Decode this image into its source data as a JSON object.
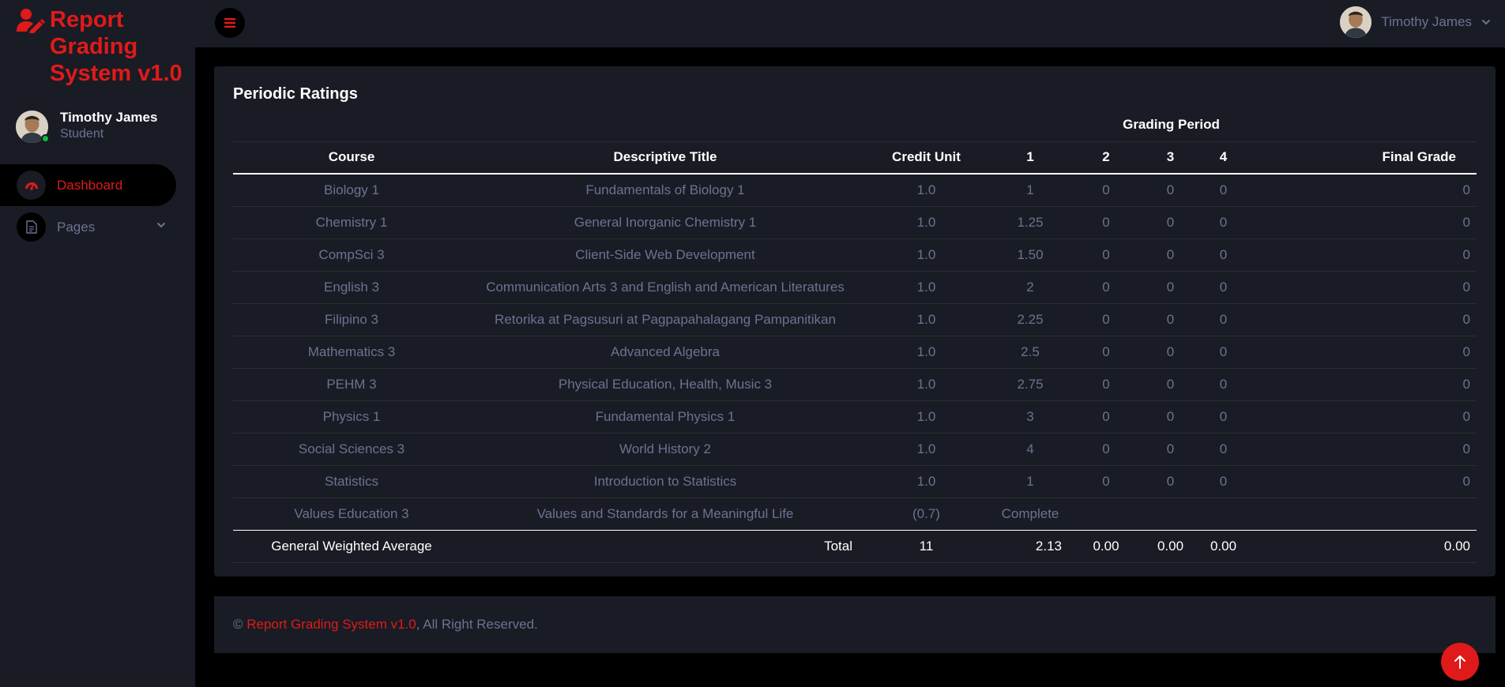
{
  "brand": {
    "title": "Report Grading System v1.0"
  },
  "sidebar": {
    "profile": {
      "name": "Timothy James",
      "role": "Student"
    },
    "items": [
      {
        "label": "Dashboard",
        "icon": "speedometer-icon",
        "active": true
      },
      {
        "label": "Pages",
        "icon": "document-icon",
        "active": false
      }
    ]
  },
  "topbar": {
    "user_name": "Timothy James"
  },
  "main": {
    "card_title": "Periodic Ratings",
    "table": {
      "group_header": "Grading Period",
      "headers": [
        "Course",
        "Descriptive Title",
        "Credit Unit",
        "1",
        "2",
        "3",
        "4",
        "Final Grade"
      ],
      "rows": [
        [
          "Biology 1",
          "Fundamentals of Biology 1",
          "1.0",
          "1",
          "0",
          "0",
          "0",
          "0"
        ],
        [
          "Chemistry 1",
          "General Inorganic Chemistry 1",
          "1.0",
          "1.25",
          "0",
          "0",
          "0",
          "0"
        ],
        [
          "CompSci 3",
          "Client-Side Web Development",
          "1.0",
          "1.50",
          "0",
          "0",
          "0",
          "0"
        ],
        [
          "English 3",
          "Communication Arts 3 and English and American Literatures",
          "1.0",
          "2",
          "0",
          "0",
          "0",
          "0"
        ],
        [
          "Filipino 3",
          "Retorika at Pagsusuri at Pagpapahalagang Pampanitikan",
          "1.0",
          "2.25",
          "0",
          "0",
          "0",
          "0"
        ],
        [
          "Mathematics 3",
          "Advanced Algebra",
          "1.0",
          "2.5",
          "0",
          "0",
          "0",
          "0"
        ],
        [
          "PEHM 3",
          "Physical Education, Health, Music 3",
          "1.0",
          "2.75",
          "0",
          "0",
          "0",
          "0"
        ],
        [
          "Physics 1",
          "Fundamental Physics 1",
          "1.0",
          "3",
          "0",
          "0",
          "0",
          "0"
        ],
        [
          "Social Sciences 3",
          "World History 2",
          "1.0",
          "4",
          "0",
          "0",
          "0",
          "0"
        ],
        [
          "Statistics",
          "Introduction to Statistics",
          "1.0",
          "1",
          "0",
          "0",
          "0",
          "0"
        ],
        [
          "Values Education 3",
          "Values and Standards for a Meaningful Life",
          "(0.7)",
          "Complete",
          "",
          "",
          "",
          ""
        ]
      ],
      "total_row": {
        "label": "General Weighted Average",
        "total_label": "Total",
        "credit_total": "11",
        "p1": "2.13",
        "p2": "0.00",
        "p3": "0.00",
        "p4": "0.00",
        "final": "0.00"
      }
    }
  },
  "footer": {
    "prefix": "© ",
    "brand": "Report Grading System v1.0",
    "suffix": ", All Right Reserved."
  },
  "colors": {
    "accent": "#e01a1a",
    "panel": "#191c24",
    "background": "#000000",
    "muted_text": "#6c7293"
  }
}
